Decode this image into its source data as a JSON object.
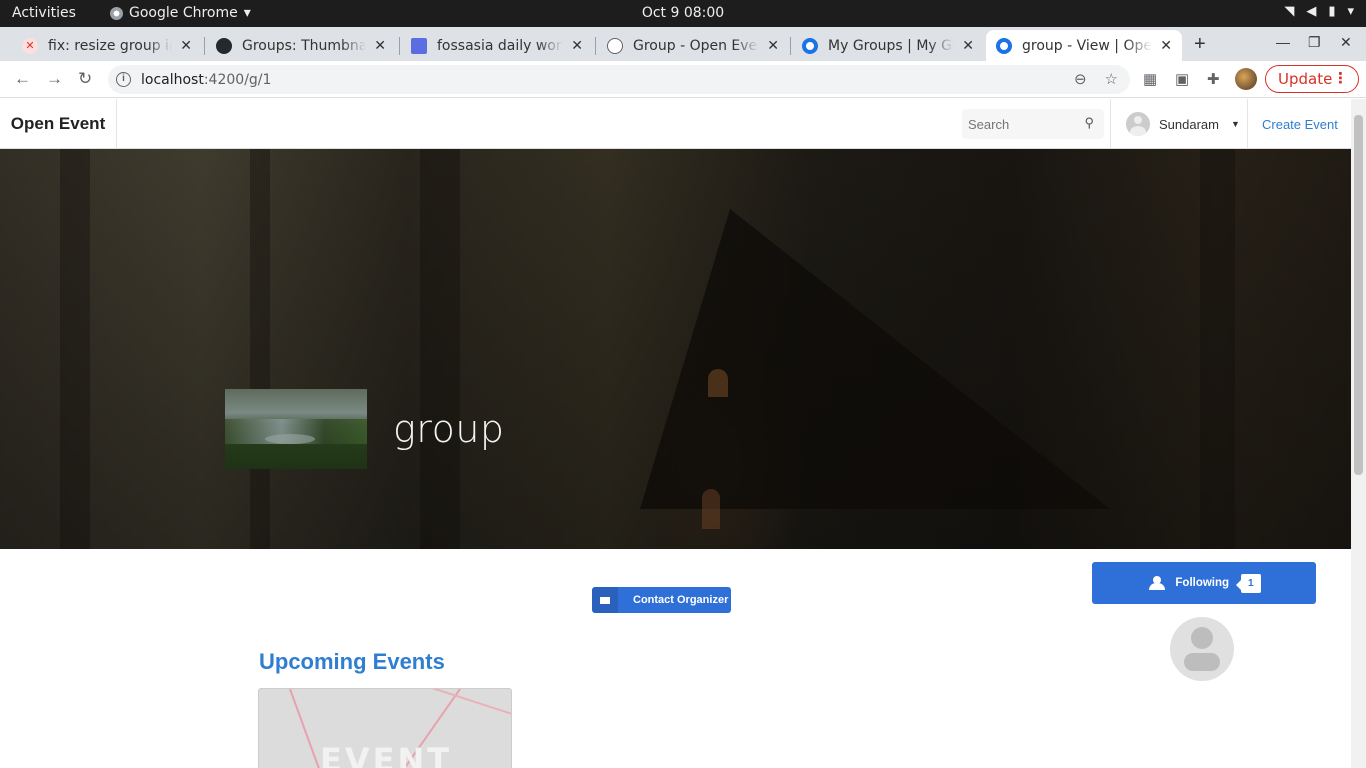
{
  "os": {
    "activities": "Activities",
    "app_name": "Google Chrome",
    "clock": "Oct 9  08:00"
  },
  "tabs": [
    {
      "label": "fix: resize group im",
      "favicon": "red-x-favicon"
    },
    {
      "label": "Groups: Thumbnail",
      "favicon": "github-icon"
    },
    {
      "label": "fossasia daily work",
      "favicon": "docs-icon"
    },
    {
      "label": "Group - Open Event",
      "favicon": "globe-icon"
    },
    {
      "label": "My Groups | My Gro",
      "favicon": "open-event-icon"
    },
    {
      "label": "group - View | Oper",
      "favicon": "open-event-icon",
      "active": true
    }
  ],
  "address_bar": {
    "host": "localhost",
    "path": ":4200/g/1"
  },
  "update_label": "Update",
  "navbar": {
    "brand": "Open Event",
    "search_placeholder": "Search",
    "user_name": "Sundaram",
    "create_event": "Create Event"
  },
  "group": {
    "name": "group",
    "contact_label": "Contact Organizer",
    "following_label": "Following",
    "follower_count": "1"
  },
  "upcoming": {
    "heading": "Upcoming Events",
    "card_text": "EVENT"
  },
  "colors": {
    "primary": "#2f6fd8",
    "link": "#2f7ed1",
    "update_red": "#d93025"
  }
}
